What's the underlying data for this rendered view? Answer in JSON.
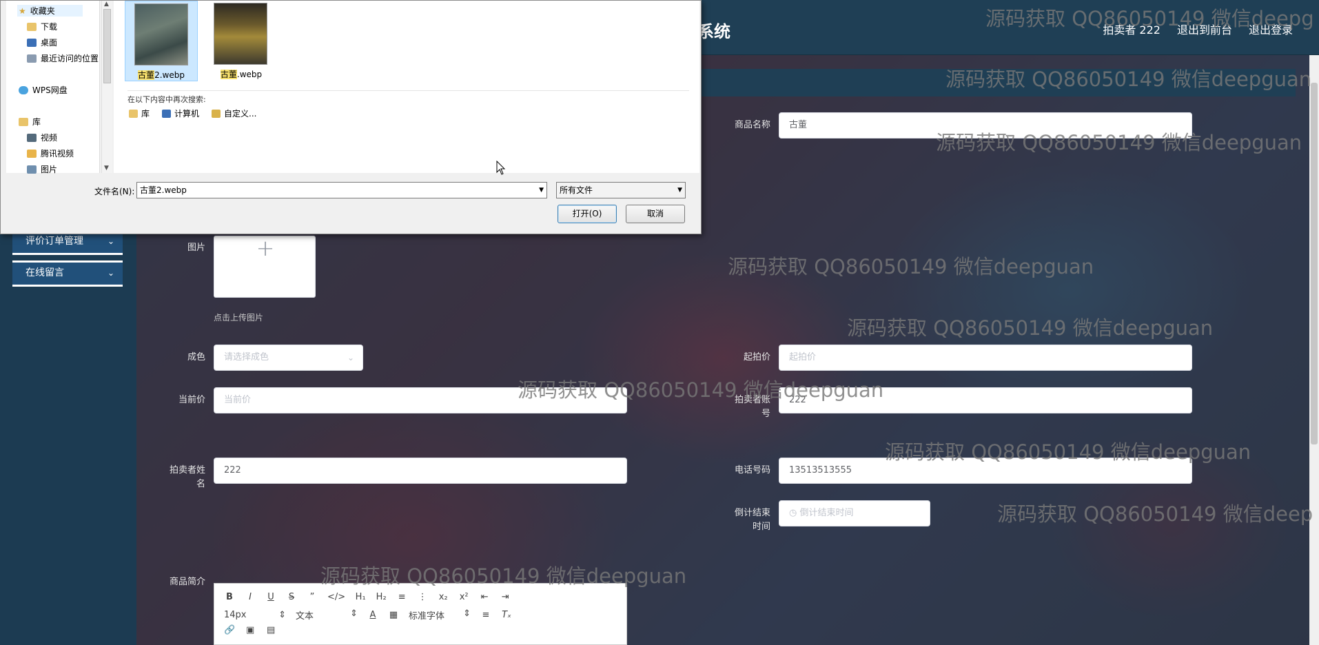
{
  "app": {
    "title_fragment": "系统"
  },
  "top_nav": {
    "user": "拍卖者 222",
    "front": "退出到前台",
    "logout": "退出登录"
  },
  "sidebar": {
    "items": [
      {
        "label": "评价订单管理"
      },
      {
        "label": "在线留言"
      }
    ]
  },
  "form": {
    "name_label": "商品名称",
    "name_value": "古董",
    "image_label": "图片",
    "image_hint": "点击上传图片",
    "condition_label": "成色",
    "condition_placeholder": "请选择成色",
    "start_price_label": "起拍价",
    "start_price_placeholder": "起拍价",
    "current_price_label": "当前价",
    "current_price_placeholder": "当前价",
    "seller_account_label": "拍卖者账号",
    "seller_account_value": "222",
    "seller_name_label": "拍卖者姓名",
    "seller_name_value": "222",
    "phone_label": "电话号码",
    "phone_value": "13513513555",
    "countdown_label": "倒计结束时间",
    "countdown_placeholder": "倒计结束时间",
    "intro_label": "商品简介"
  },
  "editor": {
    "font_size": "14px",
    "text_style": "文本",
    "font_family": "标准字体"
  },
  "dialog": {
    "nav": [
      "收藏夹",
      "下载",
      "桌面",
      "最近访问的位置",
      "WPS网盘",
      "库",
      "视频",
      "腾讯视频",
      "图片"
    ],
    "files": [
      {
        "name_hl": "古董",
        "name_rest": "2.webp"
      },
      {
        "name_hl": "古董",
        "name_rest": ".webp"
      }
    ],
    "search_again": "在以下内容中再次搜索:",
    "search_links": [
      "库",
      "计算机",
      "自定义..."
    ],
    "filename_label": "文件名(N):",
    "filename_value": "古董2.webp",
    "filetype": "所有文件",
    "open": "打开(O)",
    "cancel": "取消"
  },
  "watermark": "源码获取 QQ86050149 微信deepguan",
  "watermark_cut_1": "源码获取 QQ86050149 微信deepg",
  "watermark_cut_2": "源码获取 QQ86050149 微信deep"
}
